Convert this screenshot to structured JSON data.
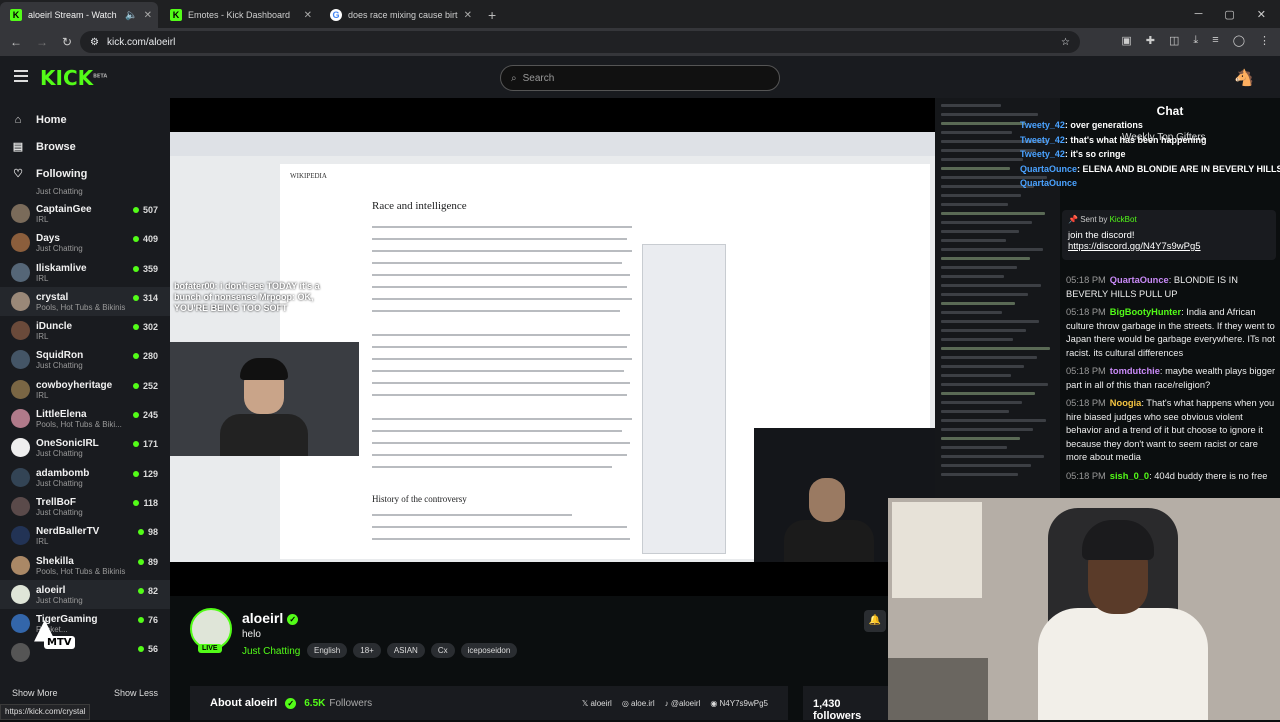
{
  "browser": {
    "tabs": [
      {
        "label": "aloeirl Stream - Watch Live",
        "fav": "K",
        "active": true
      },
      {
        "label": "Emotes - Kick Dashboard",
        "fav": "K",
        "active": false
      },
      {
        "label": "does race mixing cause birth de",
        "fav": "G",
        "active": false
      }
    ],
    "url": "kick.com/aloeirl",
    "status_url": "https://kick.com/crystal"
  },
  "kick": {
    "search_placeholder": "Search",
    "logo": "KICK",
    "logo_beta": "BETA"
  },
  "sidebar": {
    "nav": [
      {
        "label": "Home",
        "icon": "home-icon"
      },
      {
        "label": "Browse",
        "icon": "browse-icon"
      },
      {
        "label": "Following",
        "icon": "heart-icon"
      }
    ],
    "first_cat": "Just Chatting",
    "channels": [
      {
        "name": "CaptainGee",
        "cat": "IRL",
        "viewers": "507",
        "color": "#7a6b5a"
      },
      {
        "name": "Days",
        "cat": "Just Chatting",
        "viewers": "409",
        "color": "#8b5e3c"
      },
      {
        "name": "Iliskamlive",
        "cat": "IRL",
        "viewers": "359",
        "color": "#556677"
      },
      {
        "name": "crystal",
        "cat": "Pools, Hot Tubs & Bikinis",
        "viewers": "314",
        "color": "#9a8878",
        "hl": true
      },
      {
        "name": "iDuncle",
        "cat": "IRL",
        "viewers": "302",
        "color": "#6a4a3a"
      },
      {
        "name": "SquidRon",
        "cat": "Just Chatting",
        "viewers": "280",
        "color": "#445566"
      },
      {
        "name": "cowboyheritage",
        "cat": "IRL",
        "viewers": "252",
        "color": "#7a6644"
      },
      {
        "name": "LittleElena",
        "cat": "Pools, Hot Tubs & Biki...",
        "viewers": "245",
        "color": "#b07a8a"
      },
      {
        "name": "OneSonicIRL",
        "cat": "Just Chatting",
        "viewers": "171",
        "color": "#eeeeee"
      },
      {
        "name": "adambomb",
        "cat": "Just Chatting",
        "viewers": "129",
        "color": "#334455"
      },
      {
        "name": "TrellBoF",
        "cat": "Just Chatting",
        "viewers": "118",
        "color": "#5a4a4a"
      },
      {
        "name": "NerdBallerTV",
        "cat": "IRL",
        "viewers": "98",
        "color": "#223355"
      },
      {
        "name": "Shekilla",
        "cat": "Pools, Hot Tubs & Bikinis",
        "viewers": "89",
        "color": "#aa8866"
      },
      {
        "name": "aloeirl",
        "cat": "Just Chatting",
        "viewers": "82",
        "color": "#dfe5d8",
        "hl": true
      },
      {
        "name": "TigerGaming",
        "cat": "Rocket...",
        "viewers": "76",
        "color": "#3366aa"
      },
      {
        "name": "",
        "cat": "",
        "viewers": "56",
        "color": "#555555"
      }
    ],
    "show_more": "Show More",
    "show_less": "Show Less"
  },
  "player": {
    "wiki_title": "Race and intelligence",
    "wiki_section": "History of the controversy",
    "wiki_logo": "WIKIPEDIA",
    "overlay_text": "bofater00: i don't see TODAY it's a bunch of nonsense\nMrpoop: OK, YOU'RE BEING TOO SOFT"
  },
  "stream": {
    "name": "aloeirl",
    "title": "helo",
    "category": "Just Chatting",
    "live": "LIVE",
    "tags": [
      "English",
      "18+",
      "ASIAN",
      "Cx",
      "iceposeidon"
    ],
    "about": "About aloeirl",
    "followers_count": "6.5K",
    "followers_word": "Followers",
    "socials": [
      "aloeirl",
      "aloe.irl",
      "@aloeirl",
      "N4Y7s9wPg5"
    ],
    "followers_box": "1,430 followers"
  },
  "chat": {
    "title": "Chat",
    "gifters": "Weekly Top Gifters",
    "ticker": [
      {
        "user": "Tweety_42",
        "text": ": over generations"
      },
      {
        "user": "Tweety_42",
        "text": ": that's what has been happening"
      },
      {
        "user": "Tweety_42",
        "text": ": it's so cringe"
      },
      {
        "user": "QuartaOunce",
        "text": ": ELENA AND BLONDIE ARE IN BEVERLY HILLS PULL UP"
      },
      {
        "user": "QuartaOunce",
        "text": ""
      }
    ],
    "pinned": {
      "sent_by": "Sent by",
      "sender": "KickBot",
      "message": "join the discord!",
      "link": "https://discord.gg/N4Y7s9wPg5"
    },
    "messages": [
      {
        "time": "05:18 PM",
        "user": "QuartaOunce",
        "text": ": BLONDIE IS IN BEVERLY HILLS  PULL UP",
        "cls": "u3"
      },
      {
        "time": "05:18 PM",
        "user": "BigBootyHunter",
        "text": ": India and African culture throw garbage in the streets. If they went to Japan there would be garbage everywhere. ITs not racist. its cultural differences",
        "cls": "u5"
      },
      {
        "time": "05:18 PM",
        "user": "tomdutchie",
        "text": ": maybe wealth plays bigger part in all of this than race/religion?",
        "cls": "u3"
      },
      {
        "time": "05:18 PM",
        "user": "Noogia",
        "text": ": That's what happens when you hire biased judges who see obvious violent behavior and a trend of it but choose to ignore it because they don't want to seem racist or care more about media",
        "cls": "u2"
      },
      {
        "time": "05:18 PM",
        "user": "sish_0_0",
        "text": ": 404d buddy there is no free",
        "cls": "u5"
      }
    ]
  },
  "overlay_logo": "MTV"
}
